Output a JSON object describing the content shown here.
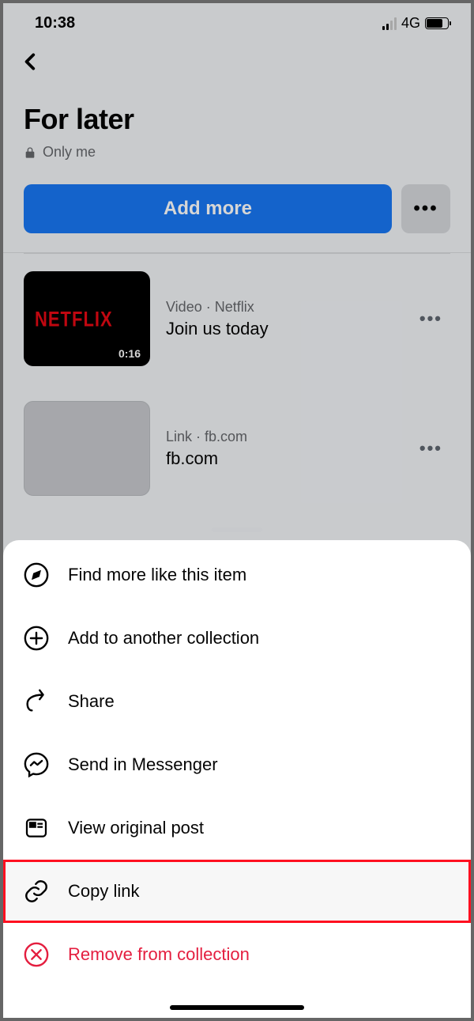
{
  "statusbar": {
    "time": "10:38",
    "network": "4G"
  },
  "header": {
    "title": "For later",
    "privacy": "Only me"
  },
  "buttons": {
    "add_more": "Add more"
  },
  "items": [
    {
      "meta": "Video · Netflix",
      "title": "Join us today",
      "duration": "0:16",
      "brand": "NETFLIX"
    },
    {
      "meta": "Link · fb.com",
      "title": "fb.com"
    }
  ],
  "sheet": {
    "find_more": "Find more like this item",
    "add_collection": "Add to another collection",
    "share": "Share",
    "messenger": "Send in Messenger",
    "view_post": "View original post",
    "copy_link": "Copy link",
    "remove": "Remove from collection"
  }
}
